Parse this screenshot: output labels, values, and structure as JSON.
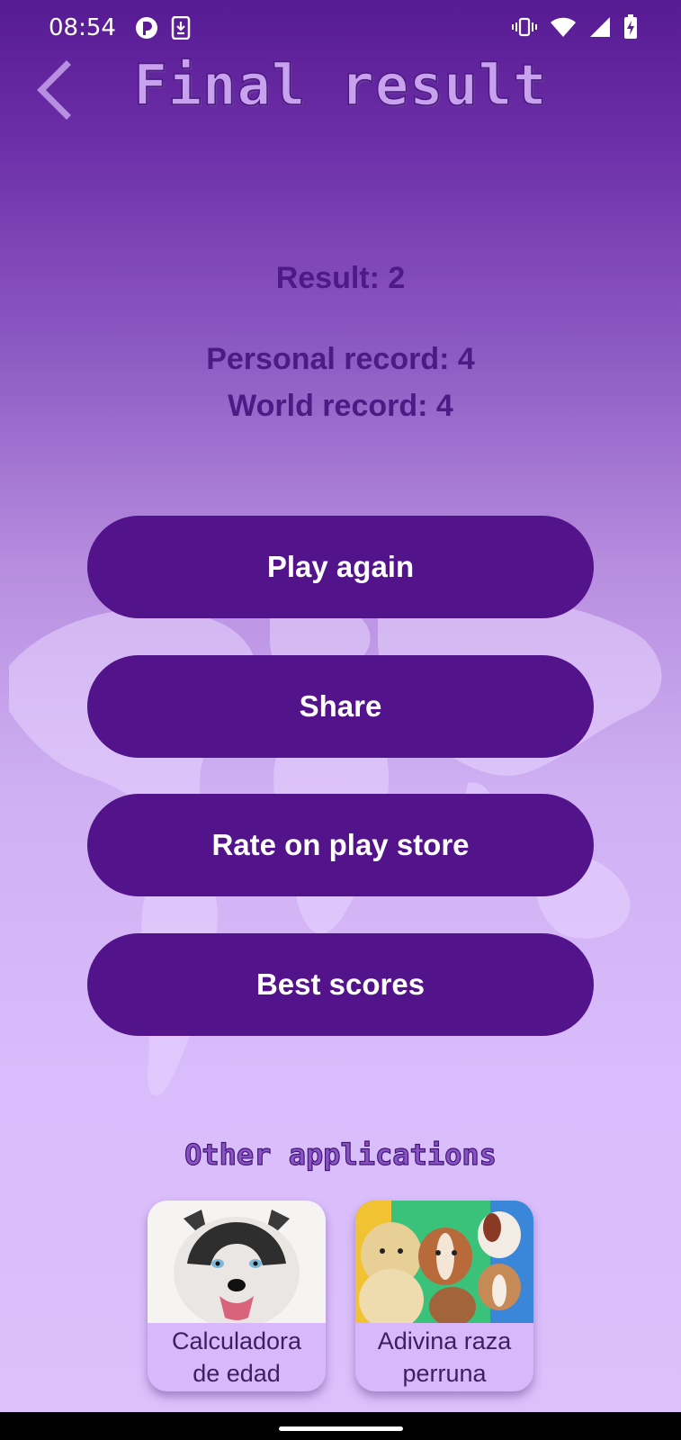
{
  "status_bar": {
    "time": "08:54",
    "left_icons": [
      "app-notification-icon",
      "download-icon"
    ],
    "right_icons": [
      "vibrate-icon",
      "wifi-icon",
      "signal-icon",
      "battery-charging-icon"
    ]
  },
  "header": {
    "back_icon": "chevron-left-icon",
    "title": "Final result"
  },
  "stats": {
    "result": "Result: 2",
    "personal_record": "Personal record: 4",
    "world_record": "World record: 4"
  },
  "actions": {
    "play_again": "Play again",
    "share": "Share",
    "rate": "Rate on play store",
    "best_scores": "Best scores"
  },
  "other_apps": {
    "title": "Other applications",
    "items": [
      {
        "label": "Calculadora\nde edad",
        "icon": "husky-dog-image"
      },
      {
        "label": "Adivina raza\nperruna",
        "icon": "puppies-image"
      }
    ]
  },
  "colors": {
    "button": "#53138b",
    "stat_text": "#4e1a86",
    "title_fill": "#c8a2ee"
  }
}
